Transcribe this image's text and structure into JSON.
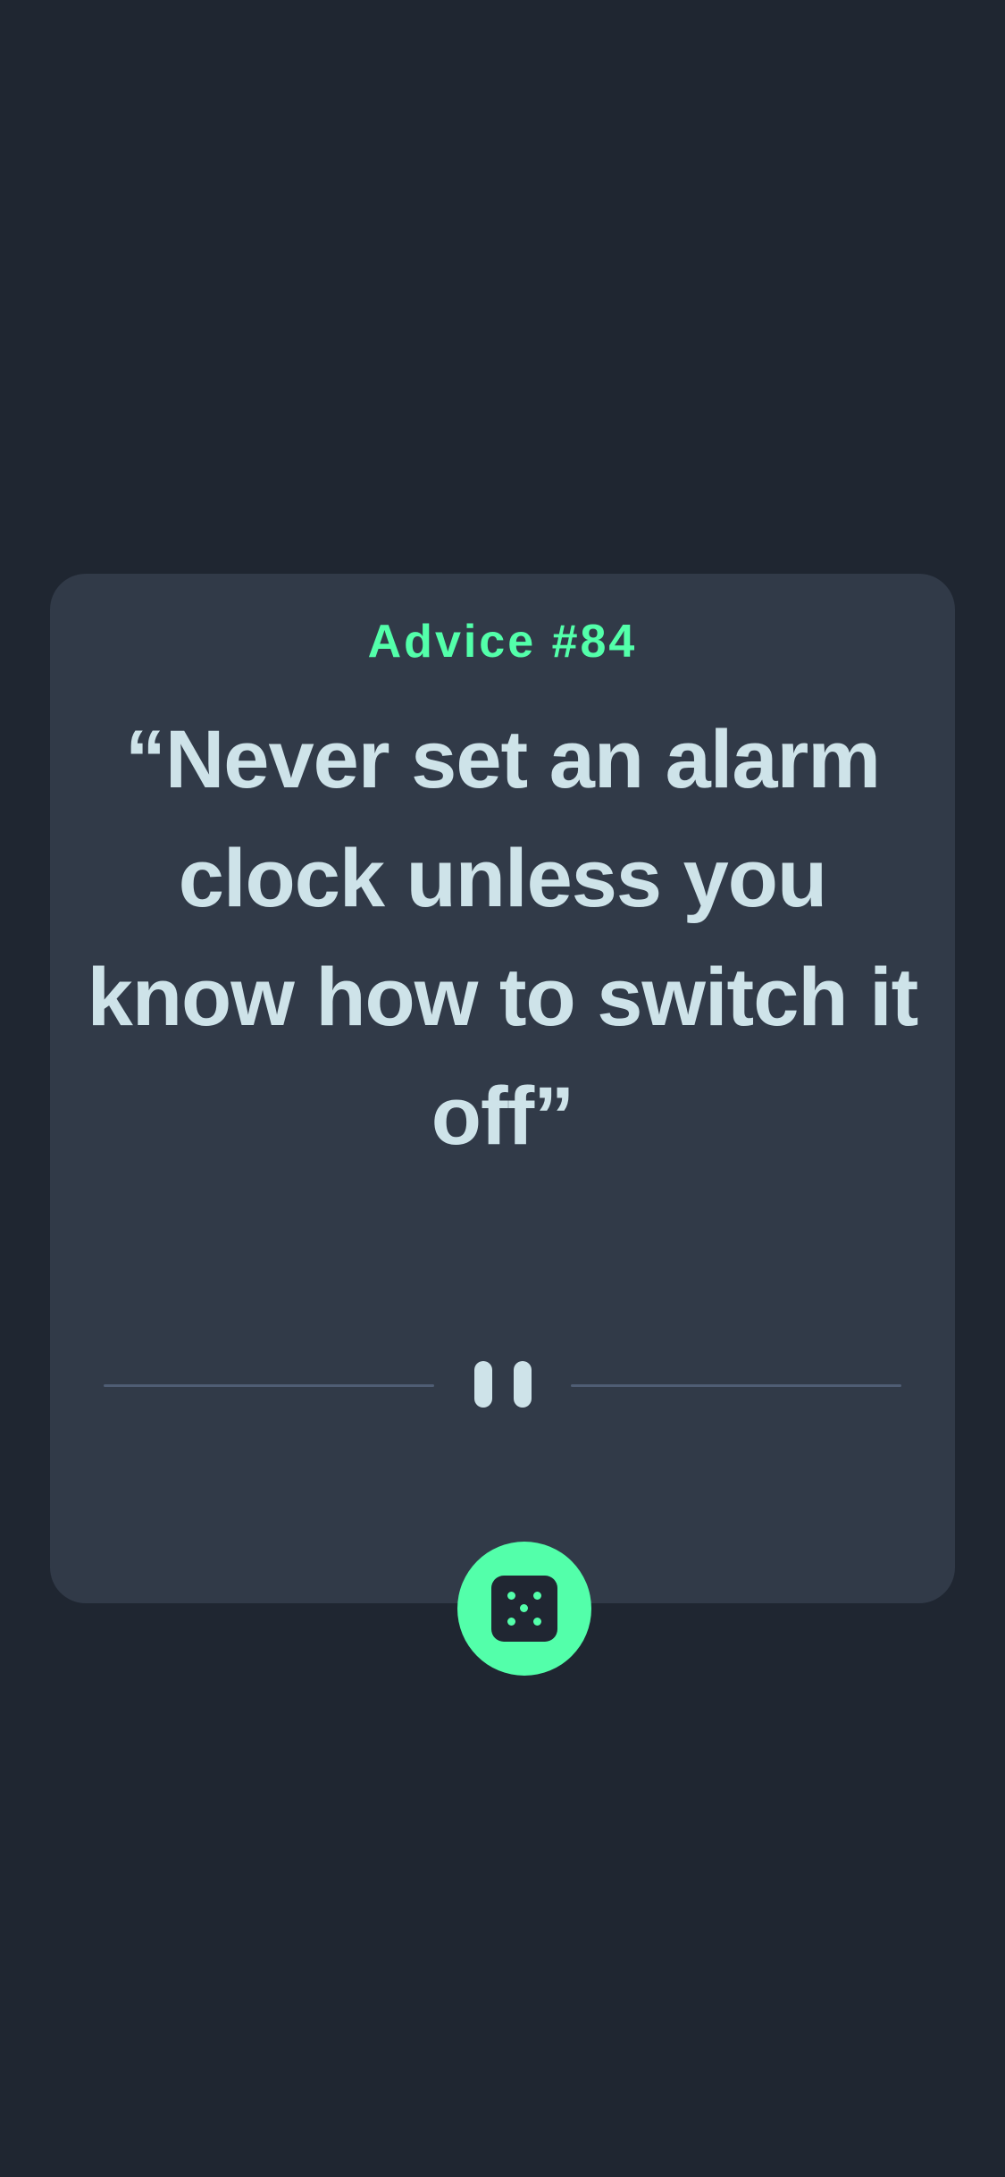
{
  "advice": {
    "title": "Advice #84",
    "quote": "“Never set an alarm clock unless you know how to switch it off”"
  },
  "divider": {
    "icon": "pause-icon"
  },
  "dice_button": {
    "icon": "dice-icon"
  },
  "colors": {
    "background": "#1f2631",
    "card": "#313a48",
    "accent": "#53ffaa",
    "text": "#cee3e9",
    "divider_line": "#4f5d74"
  }
}
